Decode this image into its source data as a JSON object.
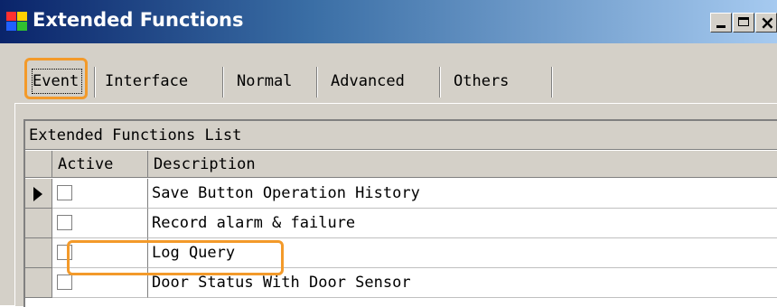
{
  "window": {
    "title": "Extended Functions",
    "minimize_label": "_",
    "close_label": "✕"
  },
  "tabs": [
    {
      "label": "Event",
      "selected": true
    },
    {
      "label": "Interface"
    },
    {
      "label": "Normal"
    },
    {
      "label": "Advanced"
    },
    {
      "label": "Others"
    }
  ],
  "grid": {
    "caption": "Extended Functions List",
    "columns": [
      "Active",
      "Description"
    ],
    "rows": [
      {
        "active": false,
        "description": "Save Button Operation History",
        "current": true
      },
      {
        "active": false,
        "description": "Record alarm & failure"
      },
      {
        "active": false,
        "description": "Log Query",
        "highlighted": true
      },
      {
        "active": false,
        "description": "Door Status With Door Sensor"
      }
    ]
  },
  "colors": {
    "highlight": "#f39a2a",
    "titlebar_start": "#0a246a",
    "titlebar_end": "#a6caf0",
    "control_face": "#d4d0c8"
  }
}
